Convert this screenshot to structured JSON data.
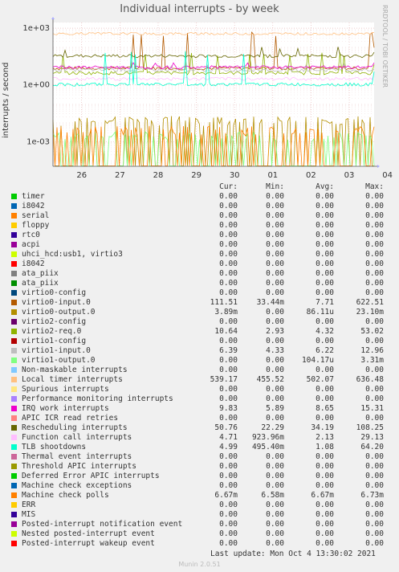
{
  "chart_data": {
    "type": "line",
    "title": "Individual interrupts - by week",
    "ylabel": "interrupts / second",
    "y_scale": "log",
    "y_ticks": [
      "1e+03",
      "1e+00",
      "1e-03"
    ],
    "ylim": [
      5e-05,
      2000
    ],
    "x_ticks": [
      "26",
      "27",
      "28",
      "29",
      "30",
      "01",
      "02",
      "03",
      "04"
    ],
    "grid": true,
    "side_credit": "RRDTOOL / TOBI OETIKER",
    "columns": [
      "Cur:",
      "Min:",
      "Avg:",
      "Max:"
    ],
    "series": [
      {
        "name": "timer",
        "color": "#00cc00",
        "values": [
          "0.00",
          "0.00",
          "0.00",
          "0.00"
        ]
      },
      {
        "name": "i8042",
        "color": "#0066b3",
        "values": [
          "0.00",
          "0.00",
          "0.00",
          "0.00"
        ]
      },
      {
        "name": "serial",
        "color": "#ff8000",
        "values": [
          "0.00",
          "0.00",
          "0.00",
          "0.00"
        ]
      },
      {
        "name": "floppy",
        "color": "#ffcc00",
        "values": [
          "0.00",
          "0.00",
          "0.00",
          "0.00"
        ]
      },
      {
        "name": "rtc0",
        "color": "#330099",
        "values": [
          "0.00",
          "0.00",
          "0.00",
          "0.00"
        ]
      },
      {
        "name": "acpi",
        "color": "#990099",
        "values": [
          "0.00",
          "0.00",
          "0.00",
          "0.00"
        ]
      },
      {
        "name": "uhci_hcd:usb1, virtio3",
        "color": "#ccff00",
        "values": [
          "0.00",
          "0.00",
          "0.00",
          "0.00"
        ]
      },
      {
        "name": "i8042",
        "color": "#ff0000",
        "values": [
          "0.00",
          "0.00",
          "0.00",
          "0.00"
        ]
      },
      {
        "name": "ata_piix",
        "color": "#808080",
        "values": [
          "0.00",
          "0.00",
          "0.00",
          "0.00"
        ]
      },
      {
        "name": "ata_piix",
        "color": "#008f00",
        "values": [
          "0.00",
          "0.00",
          "0.00",
          "0.00"
        ]
      },
      {
        "name": "virtio0-config",
        "color": "#00487d",
        "values": [
          "0.00",
          "0.00",
          "0.00",
          "0.00"
        ]
      },
      {
        "name": "virtio0-input.0",
        "color": "#b35a00",
        "values": [
          "111.51",
          "33.44m",
          "7.71",
          "622.51"
        ]
      },
      {
        "name": "virtio0-output.0",
        "color": "#b38f00",
        "values": [
          "3.89m",
          "0.00",
          "86.11u",
          "23.10m"
        ]
      },
      {
        "name": "virtio2-config",
        "color": "#6b006b",
        "values": [
          "0.00",
          "0.00",
          "0.00",
          "0.00"
        ]
      },
      {
        "name": "virtio2-req.0",
        "color": "#8fb300",
        "values": [
          "10.64",
          "2.93",
          "4.32",
          "53.02"
        ]
      },
      {
        "name": "virtio1-config",
        "color": "#b30000",
        "values": [
          "0.00",
          "0.00",
          "0.00",
          "0.00"
        ]
      },
      {
        "name": "virtio1-input.0",
        "color": "#bebebe",
        "values": [
          "6.39",
          "4.33",
          "6.22",
          "12.96"
        ]
      },
      {
        "name": "virtio1-output.0",
        "color": "#80ff80",
        "values": [
          "0.00",
          "0.00",
          "104.17u",
          "3.31m"
        ]
      },
      {
        "name": "Non-maskable interrupts",
        "color": "#80c9ff",
        "values": [
          "0.00",
          "0.00",
          "0.00",
          "0.00"
        ]
      },
      {
        "name": "Local timer interrupts",
        "color": "#ffc080",
        "values": [
          "539.17",
          "455.52",
          "502.07",
          "636.48"
        ]
      },
      {
        "name": "Spurious interrupts",
        "color": "#ffe680",
        "values": [
          "0.00",
          "0.00",
          "0.00",
          "0.00"
        ]
      },
      {
        "name": "Performance monitoring interrupts",
        "color": "#aa80ff",
        "values": [
          "0.00",
          "0.00",
          "0.00",
          "0.00"
        ]
      },
      {
        "name": "IRQ work interrupts",
        "color": "#ee00cc",
        "values": [
          "9.83",
          "5.89",
          "8.65",
          "15.31"
        ]
      },
      {
        "name": "APIC ICR read retries",
        "color": "#ff8080",
        "values": [
          "0.00",
          "0.00",
          "0.00",
          "0.00"
        ]
      },
      {
        "name": "Rescheduling interrupts",
        "color": "#666600",
        "values": [
          "50.76",
          "22.29",
          "34.19",
          "108.25"
        ]
      },
      {
        "name": "Function call interrupts",
        "color": "#ffbfff",
        "values": [
          "4.71",
          "923.96m",
          "2.13",
          "29.13"
        ]
      },
      {
        "name": "TLB shootdowns",
        "color": "#00ffcc",
        "values": [
          "4.99",
          "495.40m",
          "1.08",
          "64.20"
        ]
      },
      {
        "name": "Thermal event interrupts",
        "color": "#cc6699",
        "values": [
          "0.00",
          "0.00",
          "0.00",
          "0.00"
        ]
      },
      {
        "name": "Threshold APIC interrupts",
        "color": "#999900",
        "values": [
          "0.00",
          "0.00",
          "0.00",
          "0.00"
        ]
      },
      {
        "name": "Deferred Error APIC interrupts",
        "color": "#00cc00",
        "values": [
          "0.00",
          "0.00",
          "0.00",
          "0.00"
        ]
      },
      {
        "name": "Machine check exceptions",
        "color": "#0066b3",
        "values": [
          "0.00",
          "0.00",
          "0.00",
          "0.00"
        ]
      },
      {
        "name": "Machine check polls",
        "color": "#ff8000",
        "values": [
          "6.67m",
          "6.58m",
          "6.67m",
          "6.73m"
        ]
      },
      {
        "name": "ERR",
        "color": "#ffcc00",
        "values": [
          "0.00",
          "0.00",
          "0.00",
          "0.00"
        ]
      },
      {
        "name": "MIS",
        "color": "#330099",
        "values": [
          "0.00",
          "0.00",
          "0.00",
          "0.00"
        ]
      },
      {
        "name": "Posted-interrupt notification event",
        "color": "#990099",
        "values": [
          "0.00",
          "0.00",
          "0.00",
          "0.00"
        ]
      },
      {
        "name": "Nested posted-interrupt event",
        "color": "#ccff00",
        "values": [
          "0.00",
          "0.00",
          "0.00",
          "0.00"
        ]
      },
      {
        "name": "Posted-interrupt wakeup event",
        "color": "#ff0000",
        "values": [
          "0.00",
          "0.00",
          "0.00",
          "0.00"
        ]
      }
    ],
    "last_update": "Last update: Mon Oct  4 13:30:02 2021",
    "footer": "Munin 2.0.51"
  }
}
